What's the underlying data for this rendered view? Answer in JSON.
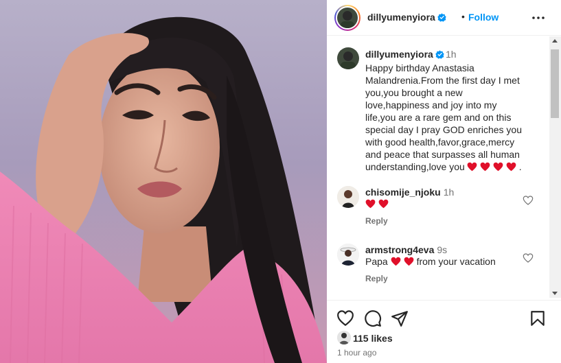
{
  "post": {
    "username": "dillyumenyiora",
    "dot": "•",
    "follow_label": "Follow"
  },
  "caption": {
    "username": "dillyumenyiora",
    "time": "1h",
    "text": "Happy birthday Anastasia Malandrenia.From the first day I met you,you brought a new love,happiness and joy into my life,you are a rare gem and on this special day I pray GOD enriches you with good health,favor,grace,mercy and peace that surpasses all human understanding,love you",
    "trailing": "."
  },
  "comments": [
    {
      "username": "chisomije_njoku",
      "time": "1h",
      "text": "",
      "reply_label": "Reply"
    },
    {
      "username": "armstrong4eva",
      "time": "9s",
      "text_before": "Papa ",
      "text_after": "from your vacation",
      "reply_label": "Reply"
    }
  ],
  "likes": "115 likes",
  "time_ago": "1 hour ago",
  "icons": {
    "verified": "verified-badge-icon",
    "more": "more-options-icon",
    "heart_emoji": "red-heart-emoji",
    "like": "heart-outline-icon",
    "comment": "comment-icon",
    "share": "share-icon",
    "save": "bookmark-icon"
  },
  "colors": {
    "accent": "#0095f6",
    "verified": "#0095f6",
    "heart": "#e0102a",
    "muted": "#737373"
  }
}
